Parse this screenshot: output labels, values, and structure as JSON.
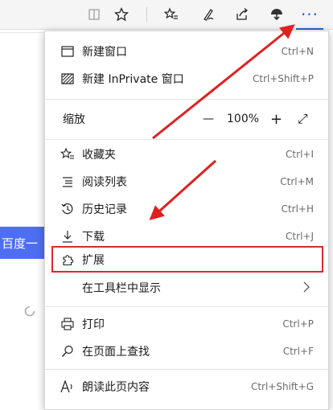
{
  "toolbar": {
    "icons": [
      "reading-view-icon",
      "favorite-star-icon",
      "favorites-list-icon",
      "pen-icon",
      "share-icon",
      "extension-icon",
      "more-icon"
    ],
    "more_label": "···"
  },
  "background": {
    "button_text": "百度一"
  },
  "menu": {
    "items": [
      {
        "label": "新建窗口",
        "shortcut": "Ctrl+N",
        "icon": "window-icon"
      },
      {
        "label": "新建 InPrivate 窗口",
        "shortcut": "Ctrl+Shift+P",
        "icon": "inprivate-icon"
      },
      {
        "label": "缩放",
        "zoom_minus": "—",
        "zoom_value": "100%",
        "zoom_plus": "+",
        "zoom_full": "⤢"
      },
      {
        "label": "收藏夹",
        "shortcut": "Ctrl+I",
        "icon": "favorites-icon"
      },
      {
        "label": "阅读列表",
        "shortcut": "Ctrl+M",
        "icon": "reading-list-icon"
      },
      {
        "label": "历史记录",
        "shortcut": "Ctrl+H",
        "icon": "history-icon"
      },
      {
        "label": "下载",
        "shortcut": "Ctrl+J",
        "icon": "download-icon"
      },
      {
        "label": "扩展",
        "shortcut": "",
        "icon": "extension-icon"
      },
      {
        "label": "在工具栏中显示",
        "shortcut": "",
        "icon": ""
      },
      {
        "label": "打印",
        "shortcut": "Ctrl+P",
        "icon": "print-icon"
      },
      {
        "label": "在页面上查找",
        "shortcut": "Ctrl+F",
        "icon": "find-icon"
      },
      {
        "label": "朗读此页内容",
        "shortcut": "Ctrl+Shift+G",
        "icon": "read-aloud-icon"
      }
    ]
  },
  "annotation": {
    "color": "#d62b2b"
  }
}
